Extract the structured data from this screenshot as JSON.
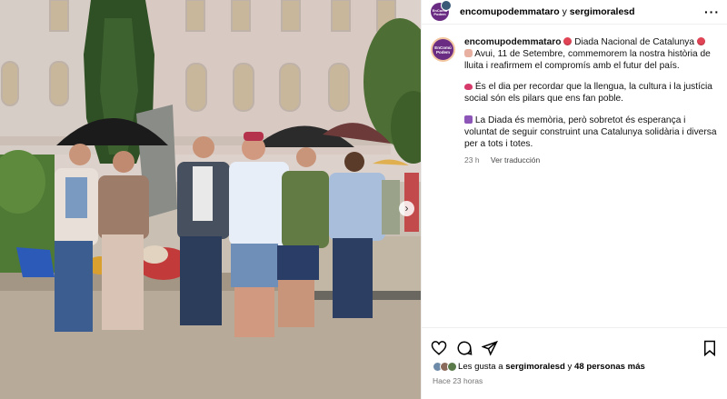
{
  "header": {
    "user1": "encomupodemmataro",
    "joiner": "y",
    "user2": "sergimoralesd",
    "more_icon": "ellipsis-icon"
  },
  "caption": {
    "username": "encomupodemmataro",
    "title": "Diada Nacional de Catalunya",
    "paragraph1": "Avui, 11 de Setembre, commemorem la nostra història de lluita i reafirmem el compromís amb el futur del país.",
    "paragraph2": "És el dia per recordar que la llengua, la cultura i la justícia social són els pilars que ens fan poble.",
    "paragraph3": "La Diada és memòria, però sobretot és esperança i voluntat de seguir construint una Catalunya solidària i diversa per a tots i totes.",
    "time": "23 h",
    "translate": "Ver traducción"
  },
  "actions": {
    "like_icon": "heart-icon",
    "comment_icon": "comment-icon",
    "share_icon": "send-icon",
    "save_icon": "bookmark-icon"
  },
  "likes": {
    "prefix": "Les gusta a",
    "user": "sergimoralesd",
    "middle": "y",
    "count": "48 personas más"
  },
  "posted": "Hace 23 horas",
  "avatar_logo": "En Comú Podem",
  "colors": {
    "brand": "#6a2c82",
    "muted": "#737373",
    "border": "#efefef"
  }
}
